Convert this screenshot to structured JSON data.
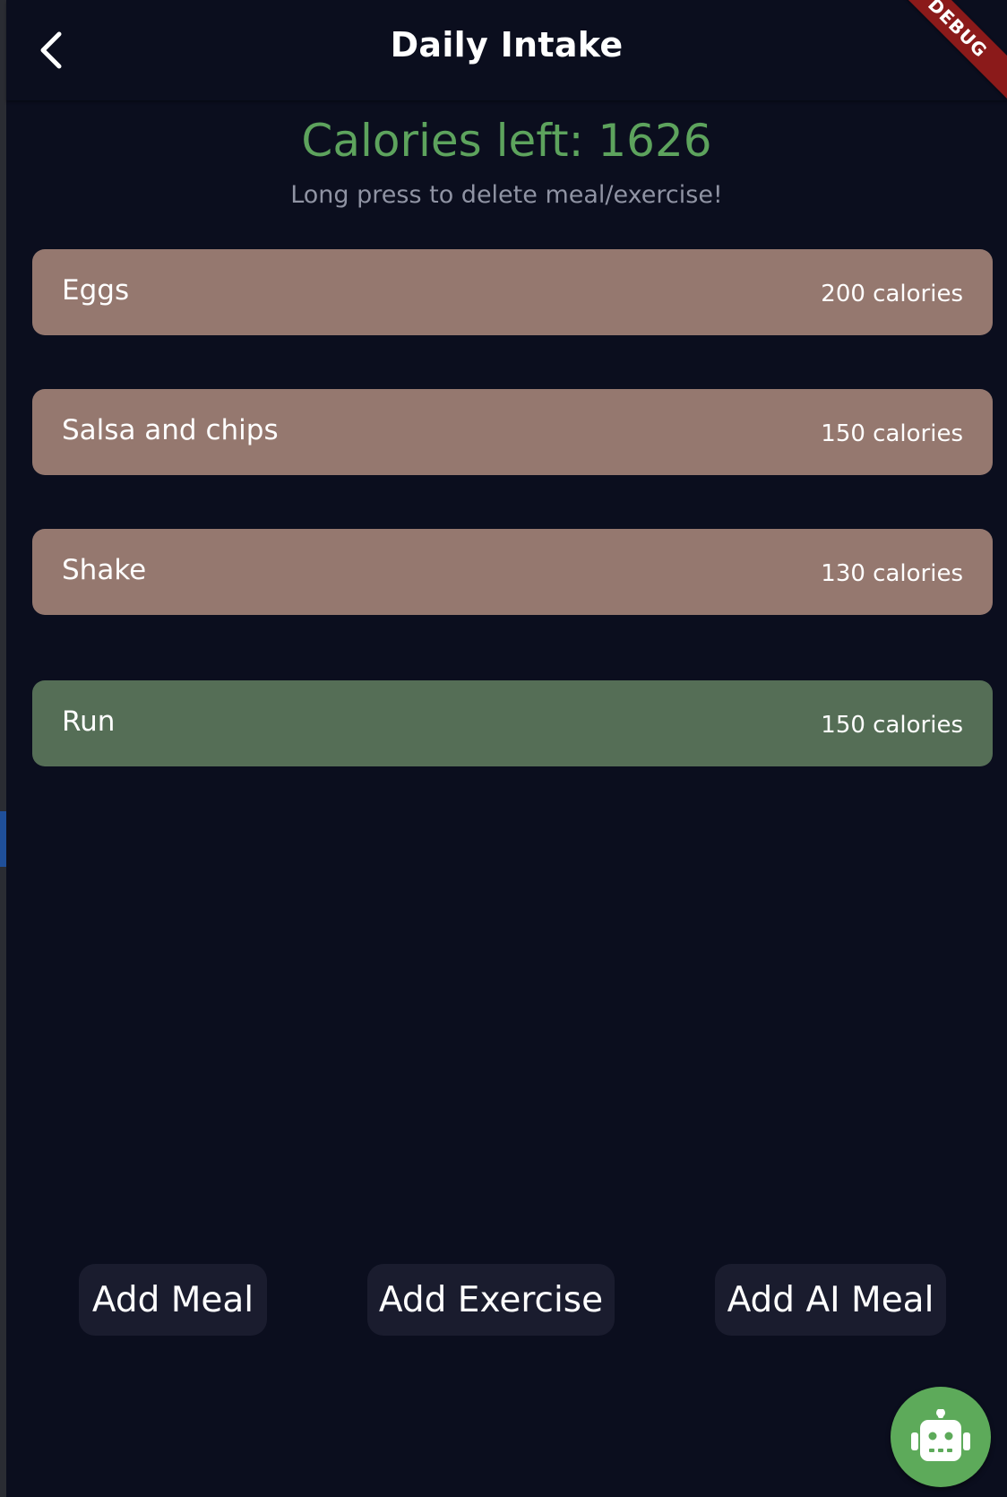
{
  "app_bar": {
    "title": "Daily Intake",
    "back_icon": "chevron-left-icon",
    "debug_label": "DEBUG"
  },
  "summary": {
    "calories_left": "Calories left: 1626",
    "hint": "Long press to delete meal/exercise!"
  },
  "entries": [
    {
      "name": "Eggs",
      "calories": "200 calories",
      "kind": "meal"
    },
    {
      "name": "Salsa and chips",
      "calories": "150 calories",
      "kind": "meal"
    },
    {
      "name": "Shake",
      "calories": "130 calories",
      "kind": "meal"
    },
    {
      "name": "Run",
      "calories": "150 calories",
      "kind": "exercise"
    }
  ],
  "actions": {
    "add_meal": "Add Meal",
    "add_exercise": "Add Exercise",
    "add_ai_meal": "Add AI Meal"
  },
  "fab": {
    "icon": "robot-icon"
  },
  "colors": {
    "background": "#0b0e1e",
    "accent_green": "#5da35d",
    "meal_card": "#95786f",
    "exercise_card": "#556e56",
    "button_bg": "#1a1c2e",
    "fab_bg": "#5daa5a",
    "debug_banner": "#8b1a1a"
  }
}
